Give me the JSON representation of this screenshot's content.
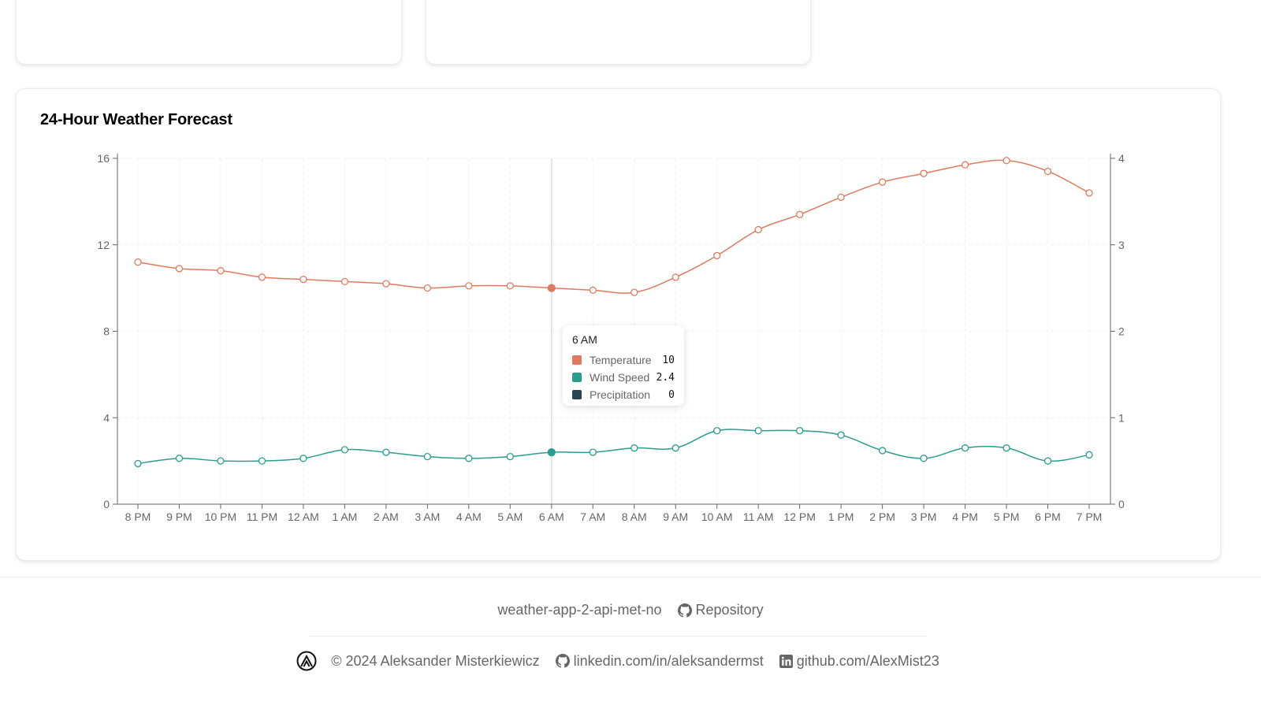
{
  "forecast": {
    "title": "24-Hour Weather Forecast"
  },
  "chart_data": {
    "type": "line",
    "x": [
      "8 PM",
      "9 PM",
      "10 PM",
      "11 PM",
      "12 AM",
      "1 AM",
      "2 AM",
      "3 AM",
      "4 AM",
      "5 AM",
      "6 AM",
      "7 AM",
      "8 AM",
      "9 AM",
      "10 AM",
      "11 AM",
      "12 PM",
      "1 PM",
      "2 PM",
      "3 PM",
      "4 PM",
      "5 PM",
      "6 PM",
      "7 PM"
    ],
    "series": [
      {
        "name": "Temperature",
        "axis": "left",
        "color": "#e07a5f",
        "values": [
          11.2,
          10.9,
          10.8,
          10.5,
          10.4,
          10.3,
          10.2,
          10.0,
          10.1,
          10.1,
          10.0,
          9.9,
          9.8,
          10.5,
          11.5,
          12.7,
          13.4,
          14.2,
          14.9,
          15.3,
          15.7,
          15.9,
          15.4,
          14.4
        ]
      },
      {
        "name": "Wind Speed",
        "axis": "right",
        "color": "#2a9d8f",
        "values": [
          0.47,
          0.53,
          0.5,
          0.5,
          0.53,
          0.63,
          0.6,
          0.55,
          0.53,
          0.55,
          0.6,
          0.6,
          0.65,
          0.65,
          0.85,
          0.85,
          0.85,
          0.8,
          0.62,
          0.53,
          0.65,
          0.65,
          0.5,
          0.57
        ]
      },
      {
        "name": "Precipitation",
        "axis": "right",
        "color": "#264653",
        "values": [
          0,
          0,
          0,
          0,
          0,
          0,
          0,
          0,
          0,
          0,
          0,
          0,
          0,
          0,
          0,
          0,
          0,
          0,
          0,
          0,
          0,
          0,
          0,
          0
        ]
      }
    ],
    "ylim_left": [
      0,
      16
    ],
    "yticks_left": [
      0,
      4,
      8,
      12,
      16
    ],
    "ylim_right": [
      0,
      4
    ],
    "yticks_right": [
      0,
      1,
      2,
      3,
      4
    ],
    "grid": true,
    "active_index": 10
  },
  "tooltip": {
    "title": "6 AM",
    "rows": [
      {
        "name": "Temperature",
        "value": "10",
        "color": "#e07a5f"
      },
      {
        "name": "Wind Speed",
        "value": "2.4",
        "color": "#2a9d8f"
      },
      {
        "name": "Precipitation",
        "value": "0",
        "color": "#264653"
      }
    ]
  },
  "footer": {
    "repo_name": "weather-app-2-api-met-no",
    "repo_link": "Repository",
    "copyright": "© 2024 Aleksander Misterkiewicz",
    "linkedin": "linkedin.com/in/aleksandermst",
    "github": "github.com/AlexMist23"
  }
}
